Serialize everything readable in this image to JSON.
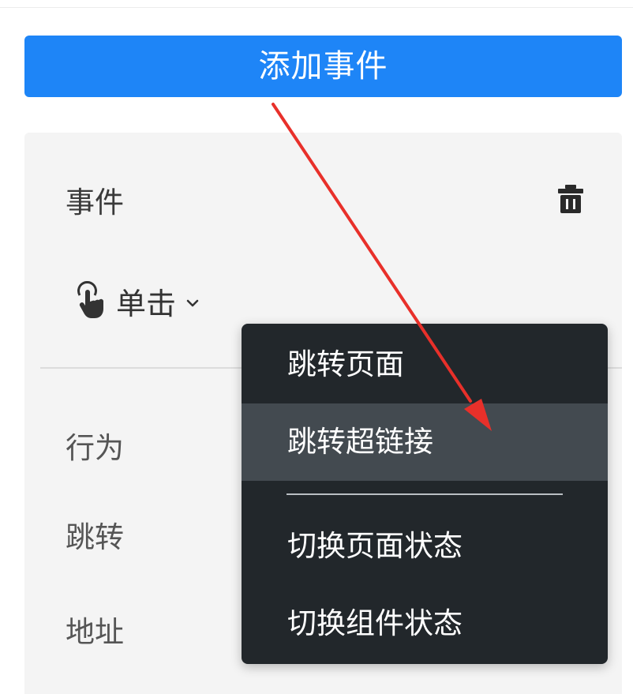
{
  "add_event_button": {
    "label": "添加事件"
  },
  "event_panel": {
    "title": "事件",
    "trigger": {
      "label": "单击",
      "icon": "tap-icon"
    },
    "fields": [
      {
        "label": "行为"
      },
      {
        "label": "跳转"
      },
      {
        "label": "地址"
      }
    ]
  },
  "dropdown": {
    "items": [
      {
        "label": "跳转页面",
        "highlighted": false
      },
      {
        "label": "跳转超链接",
        "highlighted": true
      },
      {
        "label": "切换页面状态",
        "highlighted": false
      },
      {
        "label": "切换组件状态",
        "highlighted": false
      }
    ]
  },
  "colors": {
    "primary": "#1e85f7",
    "menu_background": "#22272b",
    "menu_highlight": "#434a50",
    "annotation_arrow": "#e8302a"
  }
}
